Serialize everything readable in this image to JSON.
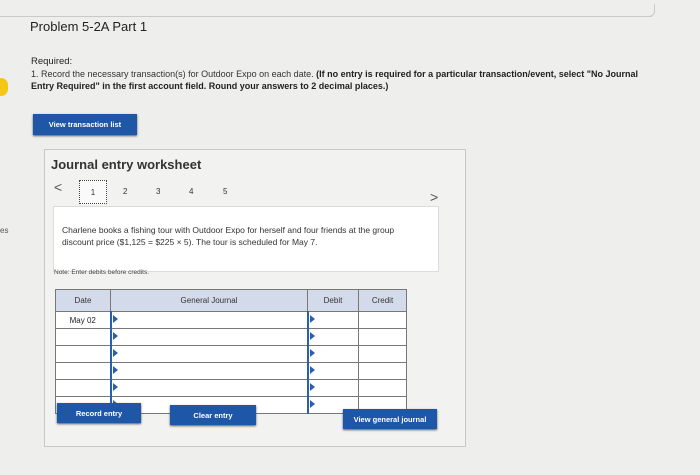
{
  "header": {
    "title": "Problem 5-2A Part 1"
  },
  "instructions": {
    "required_label": "Required:",
    "text_plain": "1. Record the necessary transaction(s) for Outdoor Expo on each date.",
    "text_bold": "(If no entry is required for a particular transaction/event, select \"No Journal Entry Required\" in the first account field. Round your answers to 2 decimal places.)"
  },
  "buttons": {
    "view_transaction_list": "View transaction list",
    "record_entry": "Record entry",
    "clear_entry": "Clear entry",
    "view_general_journal": "View general journal"
  },
  "side": {
    "cutoff_text": "es"
  },
  "worksheet": {
    "title": "Journal entry worksheet",
    "pages": [
      "1",
      "2",
      "3",
      "4",
      "5"
    ],
    "active_page": "1",
    "prev_glyph": "<",
    "next_glyph": ">",
    "description": "Charlene books a fishing tour with Outdoor Expo for herself and four friends at the group discount price ($1,125 = $225 × 5). The tour is scheduled for May 7.",
    "note": "Note: Enter debits before credits.",
    "table": {
      "headers": {
        "date": "Date",
        "account": "General Journal",
        "debit": "Debit",
        "credit": "Credit"
      },
      "rows": [
        {
          "date": "May 02",
          "account": "",
          "debit": "",
          "credit": ""
        },
        {
          "date": "",
          "account": "",
          "debit": "",
          "credit": ""
        },
        {
          "date": "",
          "account": "",
          "debit": "",
          "credit": ""
        },
        {
          "date": "",
          "account": "",
          "debit": "",
          "credit": ""
        },
        {
          "date": "",
          "account": "",
          "debit": "",
          "credit": ""
        },
        {
          "date": "",
          "account": "",
          "debit": "",
          "credit": ""
        }
      ]
    }
  },
  "colors": {
    "accent": "#1e57a8",
    "header_bg": "#d3dbeb",
    "page_bg": "#eeeeec"
  }
}
